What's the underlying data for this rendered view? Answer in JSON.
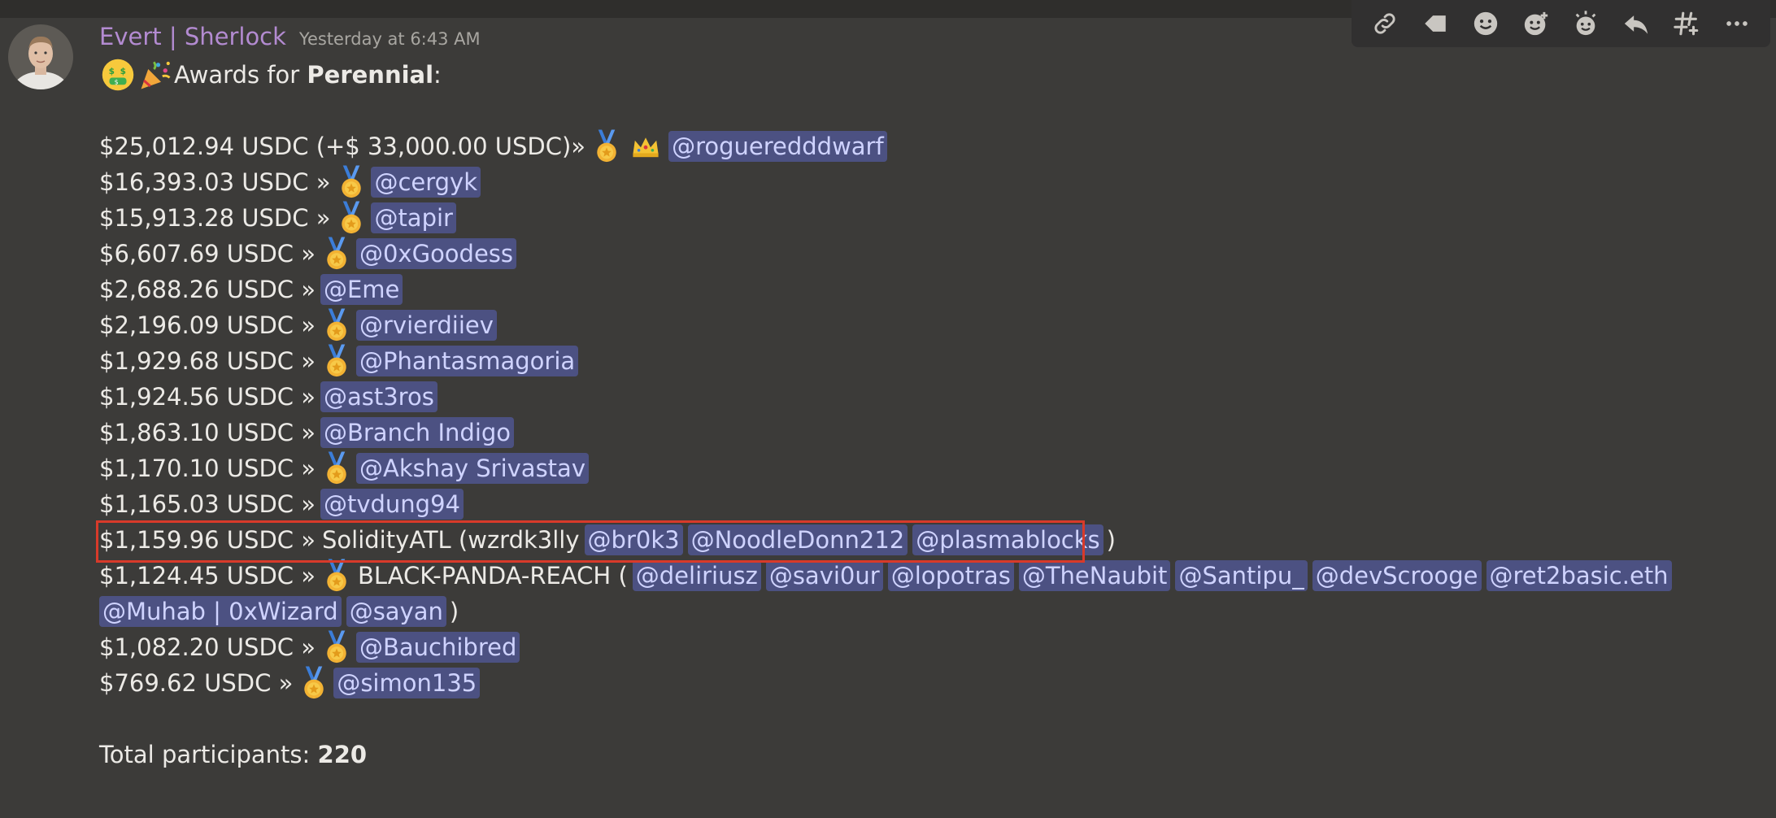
{
  "colors": {
    "background": "#3c3b39",
    "author": "#b38bd1",
    "mention_bg": "#4c5182",
    "highlight": "#d83a2a"
  },
  "toolbar": {
    "icons": [
      "link-icon",
      "tag-icon",
      "emoji-icon",
      "add-reaction-icon",
      "super-reaction-icon",
      "reply-icon",
      "thread-icon",
      "more-icon"
    ]
  },
  "message": {
    "author": "Evert | Sherlock",
    "timestamp": "Yesterday at 6:43 AM",
    "title_prefix": "Awards for ",
    "title_bold": "Perennial",
    "title_suffix": ":",
    "rows": [
      {
        "amount": "$25,012.94 USDC (+$ 33,000.00 USDC)»",
        "mentions": [
          "@rogueredddwarf"
        ]
      },
      {
        "amount": "$16,393.03 USDC »",
        "mentions": [
          "@cergyk"
        ]
      },
      {
        "amount": "$15,913.28 USDC »",
        "mentions": [
          "@tapir"
        ]
      },
      {
        "amount": "$6,607.69 USDC »",
        "mentions": [
          "@0xGoodess"
        ]
      },
      {
        "amount": "$2,688.26 USDC »",
        "mentions": [
          "@Eme"
        ]
      },
      {
        "amount": "$2,196.09 USDC »",
        "mentions": [
          "@rvierdiiev"
        ]
      },
      {
        "amount": "$1,929.68 USDC »",
        "mentions": [
          "@Phantasmagoria"
        ]
      },
      {
        "amount": "$1,924.56 USDC »",
        "mentions": [
          "@ast3ros"
        ]
      },
      {
        "amount": "$1,863.10 USDC »",
        "mentions": [
          "@Branch Indigo"
        ]
      },
      {
        "amount": "$1,170.10 USDC »",
        "mentions": [
          "@Akshay Srivastav"
        ]
      },
      {
        "amount": "$1,165.03 USDC »",
        "mentions": [
          "@tvdung94"
        ]
      },
      {
        "amount": "$1,159.96 USDC »",
        "team": "SolidityATL (wzrdk3lly",
        "mentions": [
          "@br0k3",
          "@NoodleDonn212",
          "@plasmablocks"
        ],
        "close": ")"
      },
      {
        "amount": "$1,124.45 USDC »",
        "team": "BLACK-PANDA-REACH (",
        "mentions": [
          "@deliriusz",
          "@savi0ur",
          "@lopotras",
          "@TheNaubit",
          "@Santipu_",
          "@devScrooge",
          "@ret2basic.eth"
        ]
      },
      {
        "mentions": [
          "@Muhab | 0xWizard",
          "@sayan"
        ],
        "close": ")"
      },
      {
        "amount": "$1,082.20 USDC »",
        "mentions": [
          "@Bauchibred"
        ]
      },
      {
        "amount": "$769.62 USDC »",
        "mentions": [
          "@simon135"
        ]
      }
    ],
    "total_label": "Total participants: ",
    "total_value": "220"
  }
}
